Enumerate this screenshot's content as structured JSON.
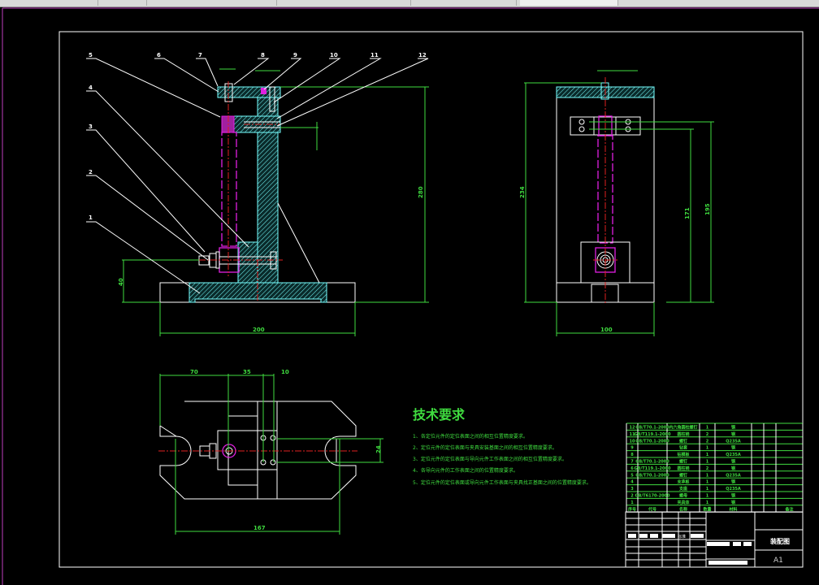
{
  "colors": {
    "background": "#000000",
    "outline": "#ffffff",
    "dimension": "#3fdc3f",
    "section": "#77ffff",
    "hidden": "#e020e0",
    "centerline": "#e02020",
    "border": "#c040c0"
  },
  "balloons": [
    "1",
    "2",
    "3",
    "4",
    "5",
    "6",
    "7",
    "8",
    "9",
    "10",
    "11",
    "12"
  ],
  "front_view": {
    "dims": {
      "height": "280",
      "base_height": "40",
      "width": "200"
    }
  },
  "side_view": {
    "dims": {
      "height": "234",
      "h1": "171",
      "h2": "195",
      "width": "100"
    }
  },
  "top_view": {
    "dims": {
      "d1": "70",
      "d2": "35",
      "d3": "10",
      "length": "167",
      "slot": "24"
    }
  },
  "tech_requirements": {
    "title": "技术要求",
    "items": [
      "1、各定位元件的定位表面之间的相互位置精度要求。",
      "2、定位元件的定位表面与夹具安装基面之间的相互位置精度要求。",
      "3、定位元件的定位表面与导向元件工作表面之间的相互位置精度要求。",
      "4、各导向元件的工作表面之间的位置精度要求。",
      "5、定位元件的定位表面或导向元件工作表面与夹具找正基面之间的位置精度要求。"
    ]
  },
  "parts_list": {
    "header": [
      "序号",
      "代号",
      "名称",
      "数量",
      "材料",
      "",
      "",
      "备注"
    ],
    "rows": [
      [
        "12",
        "GB/T70.1-2000",
        "内六角圆柱螺钉",
        "1",
        "钢"
      ],
      [
        "11",
        "GB/T119.1-2000",
        "圆柱销",
        "2",
        "钢"
      ],
      [
        "10",
        "GB/T70.1-2000",
        "螺钉",
        "2",
        "Q235A"
      ],
      [
        "9",
        "",
        "钻套",
        "1",
        "钢"
      ],
      [
        "8",
        "",
        "钻模板",
        "1",
        "Q235A"
      ],
      [
        "7",
        "GB/T70.1-2000",
        "螺钉",
        "1",
        "钢"
      ],
      [
        "6",
        "GB/T119.1-2000",
        "圆柱销",
        "2",
        "钢"
      ],
      [
        "5",
        "GB/T70.1-2000",
        "螺钉",
        "1",
        "Q235A"
      ],
      [
        "4",
        "",
        "支承板",
        "1",
        "钢"
      ],
      [
        "3",
        "",
        "支座",
        "1",
        "Q235A"
      ],
      [
        "2",
        "GB/T6170-2000",
        "螺母",
        "1",
        "钢"
      ],
      [
        "1",
        "",
        "夹具体",
        "1",
        "钢"
      ]
    ]
  },
  "title_block": {
    "drawing_name": "装配图",
    "sheet_size": "A1",
    "mark": "标准"
  }
}
